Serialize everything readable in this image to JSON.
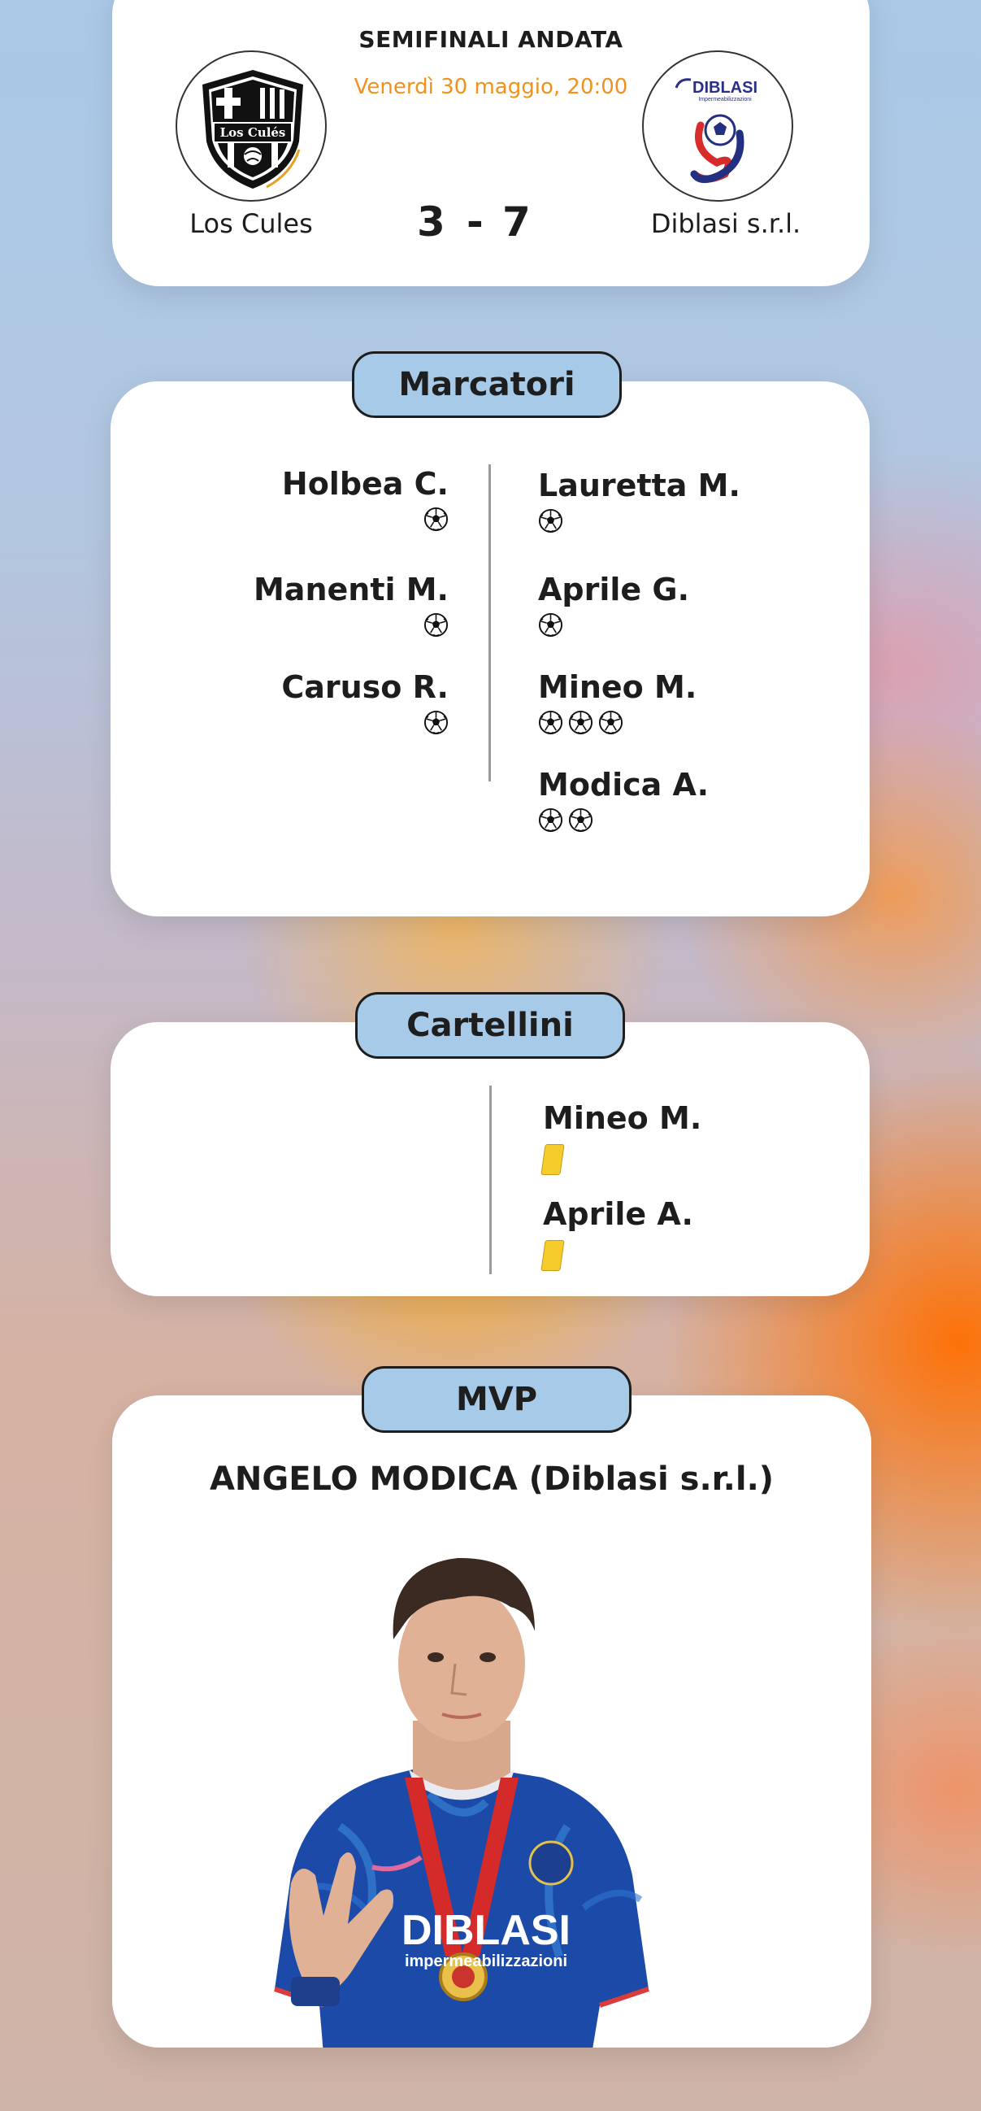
{
  "match": {
    "round": "SEMIFINALI ANDATA",
    "date": "Venerdì 30 maggio, 20:00",
    "home_team": "Los Cules",
    "away_team": "Diblasi s.r.l.",
    "home_score": "3",
    "score_separator": "-",
    "away_score": "7",
    "home_logo_text": "Los Culés",
    "away_logo_text": "DIBLASI",
    "away_logo_subtext": "Impermeabilizzazioni"
  },
  "scorers": {
    "title": "Marcatori",
    "home": [
      {
        "name": "Holbea C.",
        "goals": 1
      },
      {
        "name": "Manenti M.",
        "goals": 1
      },
      {
        "name": "Caruso R.",
        "goals": 1
      }
    ],
    "away": [
      {
        "name": "Lauretta M.",
        "goals": 1
      },
      {
        "name": "Aprile G.",
        "goals": 1
      },
      {
        "name": "Mineo M.",
        "goals": 3
      },
      {
        "name": "Modica A.",
        "goals": 2
      }
    ]
  },
  "cards": {
    "title": "Cartellini",
    "home": [],
    "away": [
      {
        "name": "Mineo M.",
        "card": "yellow"
      },
      {
        "name": "Aprile A.",
        "card": "yellow"
      }
    ]
  },
  "mvp": {
    "title": "MVP",
    "player": "ANGELO MODICA (Diblasi s.r.l.)",
    "shirt_text": "DIBLASI",
    "shirt_subtext": "impermeabilizzazioni"
  },
  "colors": {
    "accent_orange": "#f0921c",
    "pill_blue": "#a6cae8",
    "yellow_card": "#f6cc2c",
    "shirt_blue": "#1c4aa8",
    "medal_ribbon": "#d42a2a"
  },
  "icons": {
    "goal": "soccer-ball-icon",
    "card": "yellow-card-icon"
  }
}
